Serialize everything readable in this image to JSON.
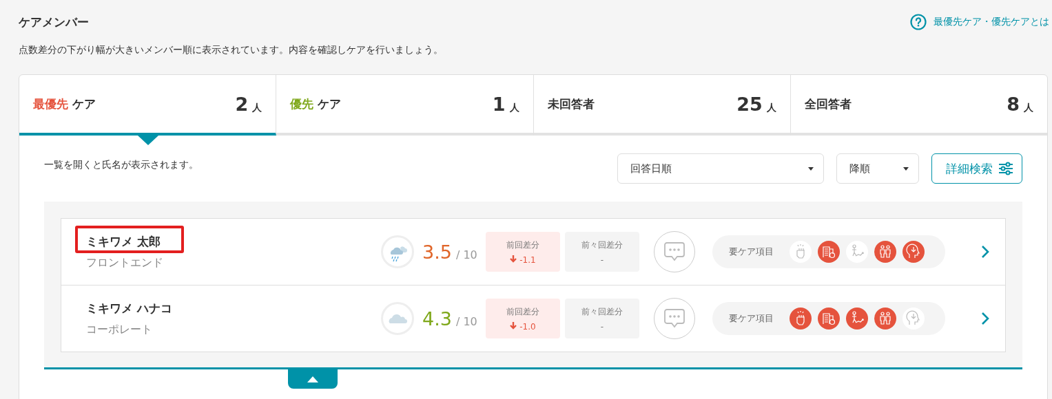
{
  "header": {
    "title": "ケアメンバー",
    "help_link": "最優先ケア・優先ケアとは",
    "description": "点数差分の下がり幅が大きいメンバー順に表示されています。内容を確認しケアを行いましょう。"
  },
  "tabs": [
    {
      "highlight": "最優先",
      "color": "#e5533d",
      "label": "ケア",
      "count": "2",
      "unit": "人",
      "selected": true
    },
    {
      "highlight": "優先",
      "color": "#7fa81b",
      "label": "ケア",
      "count": "1",
      "unit": "人",
      "selected": false
    },
    {
      "label": "未回答者",
      "count": "25",
      "unit": "人",
      "selected": false
    },
    {
      "label": "全回答者",
      "count": "8",
      "unit": "人",
      "selected": false
    }
  ],
  "toolbar": {
    "note": "一覧を開くと氏名が表示されます。",
    "sort_field": "回答日順",
    "sort_order": "降順",
    "search_button": "詳細検索"
  },
  "members": [
    {
      "name": "ミキワメ 太郎",
      "department": "フロントエンド",
      "annotated": true,
      "weather": {
        "kind": "rain"
      },
      "score": "3.5",
      "color": "#e0662a",
      "max": "/ 10",
      "diff_label": "前回差分",
      "diff": "-1.1",
      "prev_diff_label": "前々回差分",
      "prev_diff": "-",
      "care_label": "要ケア項目",
      "care_items": [
        {
          "kind": "fist",
          "on": false
        },
        {
          "kind": "building",
          "on": true
        },
        {
          "kind": "climb",
          "on": false
        },
        {
          "kind": "people",
          "on": true
        },
        {
          "kind": "head",
          "on": true
        }
      ]
    },
    {
      "name": "ミキワメ ハナコ",
      "department": "コーポレート",
      "annotated": false,
      "weather": {
        "kind": "cloud"
      },
      "score": "4.3",
      "color": "#7fa81b",
      "max": "/ 10",
      "diff_label": "前回差分",
      "diff": "-1.0",
      "prev_diff_label": "前々回差分",
      "prev_diff": "-",
      "care_label": "要ケア項目",
      "care_items": [
        {
          "kind": "fist",
          "on": true
        },
        {
          "kind": "building",
          "on": true
        },
        {
          "kind": "climb",
          "on": true
        },
        {
          "kind": "people",
          "on": true
        },
        {
          "kind": "head",
          "on": false
        }
      ]
    }
  ]
}
